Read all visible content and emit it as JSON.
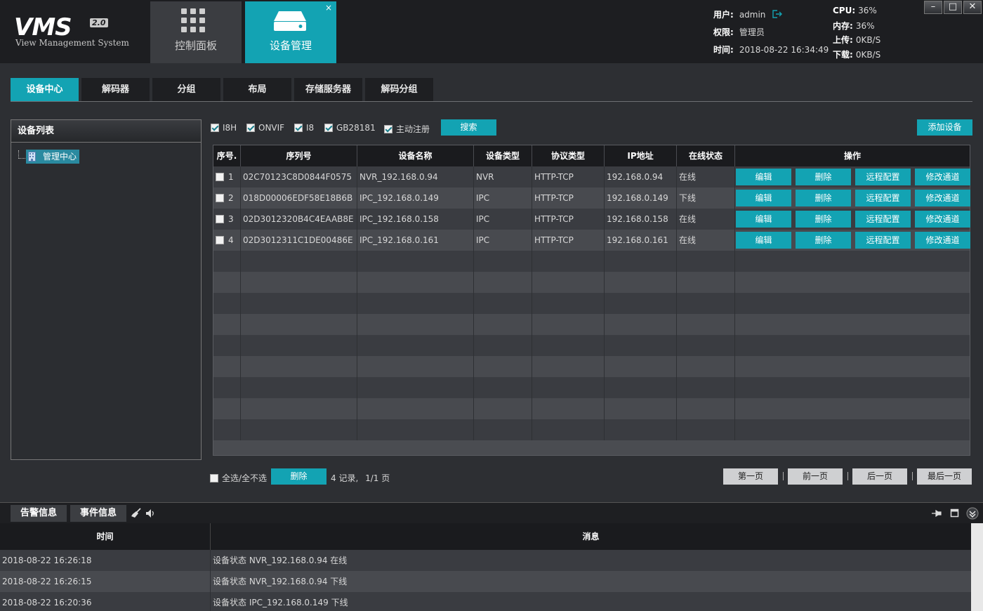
{
  "app": {
    "logo_main": "VMS",
    "logo_version": "2.0",
    "logo_subtitle": "View Management System",
    "accent_color": "#13a3b3"
  },
  "top_tabs": [
    {
      "label": "控制面板",
      "icon": "grid-icon"
    },
    {
      "label": "设备管理",
      "icon": "hard-drive-icon",
      "active": true,
      "close": "×"
    }
  ],
  "user_info": {
    "user_label": "用户:",
    "user": "admin",
    "role_label": "权限:",
    "role": "管理员",
    "time_label": "时间:",
    "time": "2018-08-22 16:34:49"
  },
  "stats": {
    "cpu_label": "CPU:",
    "cpu": "36%",
    "mem_label": "内存:",
    "mem": "36%",
    "up_label": "上传:",
    "up": "0KB/S",
    "down_label": "下载:",
    "down": "0KB/S"
  },
  "window_controls": {
    "minimize": "–",
    "maximize": "□",
    "close": "✕"
  },
  "sub_tabs": [
    "设备中心",
    "解码器",
    "分组",
    "布局",
    "存储服务器",
    "解码分组"
  ],
  "left_panel": {
    "title": "设备列表",
    "tree_root": "管理中心"
  },
  "filters": {
    "items": [
      {
        "label": "I8H",
        "checked": true
      },
      {
        "label": "ONVIF",
        "checked": true
      },
      {
        "label": "I8",
        "checked": true
      },
      {
        "label": "GB28181",
        "checked": true
      },
      {
        "label": "主动注册",
        "checked": true
      }
    ],
    "search": "搜索",
    "add_device": "添加设备"
  },
  "table": {
    "headers": [
      "序号.",
      "序列号",
      "设备名称",
      "设备类型",
      "协议类型",
      "IP地址",
      "在线状态",
      "操作"
    ],
    "actions": [
      "编辑",
      "删除",
      "远程配置",
      "修改通道"
    ],
    "rows": [
      {
        "no": "1",
        "serial": "02C70123C8D0844F0575",
        "name": "NVR_192.168.0.94",
        "type": "NVR",
        "protocol": "HTTP-TCP",
        "ip": "192.168.0.94",
        "status": "在线"
      },
      {
        "no": "2",
        "serial": "018D00006EDF58E18B6B",
        "name": "IPC_192.168.0.149",
        "type": "IPC",
        "protocol": "HTTP-TCP",
        "ip": "192.168.0.149",
        "status": "下线"
      },
      {
        "no": "3",
        "serial": "02D3012320B4C4EAAB8E",
        "name": "IPC_192.168.0.158",
        "type": "IPC",
        "protocol": "HTTP-TCP",
        "ip": "192.168.0.158",
        "status": "在线"
      },
      {
        "no": "4",
        "serial": "02D3012311C1DE00486E",
        "name": "IPC_192.168.0.161",
        "type": "IPC",
        "protocol": "HTTP-TCP",
        "ip": "192.168.0.161",
        "status": "在线"
      }
    ]
  },
  "footer": {
    "select_all": "全选/全不选",
    "delete": "删除",
    "records_count": "4",
    "records_unit": "记录,",
    "pages": "1/1",
    "pages_unit": "页",
    "first": "第一页",
    "prev": "前一页",
    "next": "后一页",
    "last": "最后一页"
  },
  "bottom_panel": {
    "tabs": [
      "告警信息",
      "事件信息"
    ],
    "headers": [
      "时间",
      "消息"
    ],
    "logs": [
      {
        "time": "2018-08-22 16:26:18",
        "message": "设备状态 NVR_192.168.0.94 在线"
      },
      {
        "time": "2018-08-22 16:26:15",
        "message": "设备状态 NVR_192.168.0.94 下线"
      },
      {
        "time": "2018-08-22 16:20:36",
        "message": "设备状态 IPC_192.168.0.149 下线"
      }
    ]
  }
}
